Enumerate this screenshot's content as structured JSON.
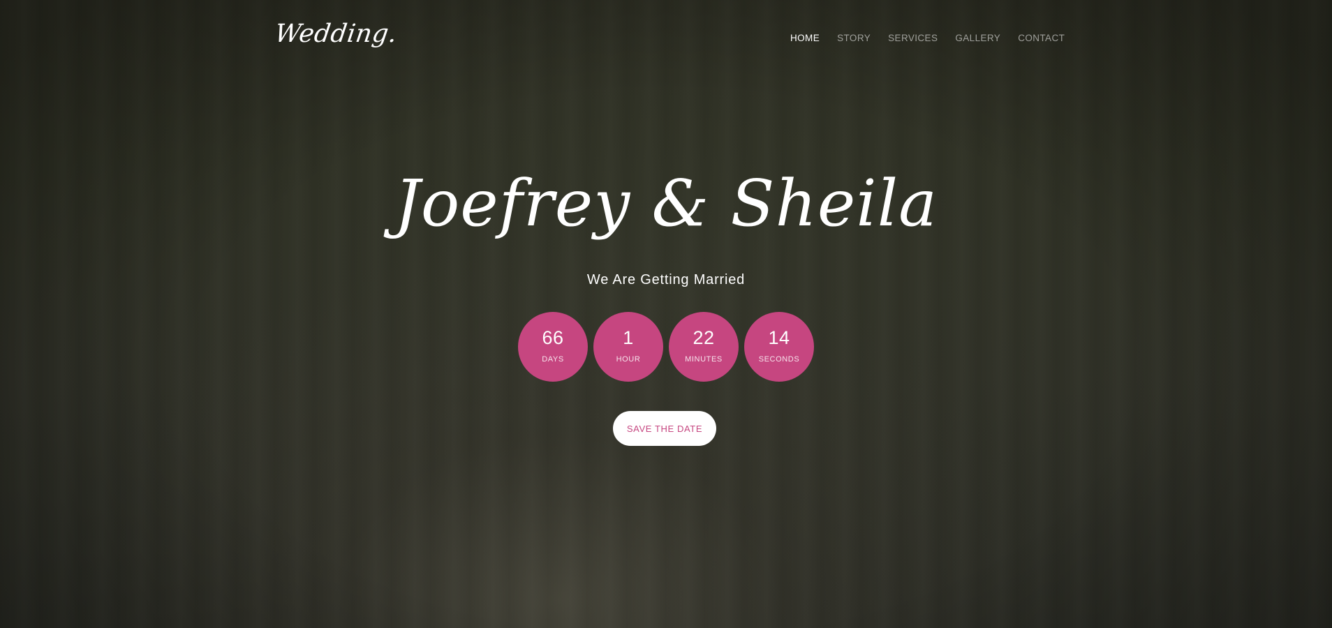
{
  "header": {
    "logo": "Wedding.",
    "nav": [
      {
        "label": "HOME",
        "active": true
      },
      {
        "label": "STORY",
        "active": false
      },
      {
        "label": "SERVICES",
        "active": false
      },
      {
        "label": "GALLERY",
        "active": false
      },
      {
        "label": "CONTACT",
        "active": false
      }
    ]
  },
  "hero": {
    "title": "Joefrey & Sheila",
    "subtitle": "We Are Getting Married",
    "countdown": [
      {
        "value": "66",
        "label": "DAYS"
      },
      {
        "value": "1",
        "label": "HOUR"
      },
      {
        "value": "22",
        "label": "MINUTES"
      },
      {
        "value": "14",
        "label": "SECONDS"
      }
    ],
    "cta_label": "SAVE THE DATE"
  },
  "colors": {
    "accent": "#c64680",
    "background": "#2c2d22",
    "text": "#ffffff"
  }
}
